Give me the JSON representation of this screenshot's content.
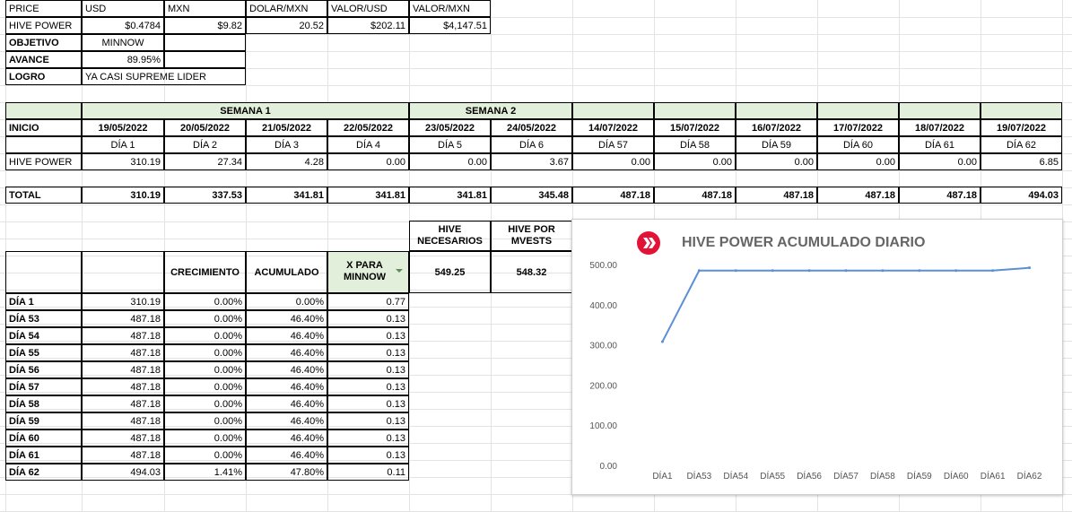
{
  "top": {
    "headers": [
      "PRICE",
      "USD",
      "MXN",
      "DOLAR/MXN",
      "VALOR/USD",
      "VALOR/MXN"
    ],
    "row_label": "HIVE POWER",
    "values": [
      "$0.4784",
      "$9.82",
      "20.52",
      "$202.11",
      "$4,147.51"
    ],
    "objetivo_label": "OBJETIVO",
    "objetivo_value": "MINNOW",
    "avance_label": "AVANCE",
    "avance_value": "89.95%",
    "logro_label": "LOGRO",
    "logro_value": "YA CASI SUPREME LIDER"
  },
  "week_table": {
    "semana1": "SEMANA 1",
    "semana2": "SEMANA 2",
    "inicio_label": "INICIO",
    "dates": [
      "19/05/2022",
      "20/05/2022",
      "21/05/2022",
      "22/05/2022",
      "23/05/2022",
      "24/05/2022",
      "14/07/2022",
      "15/07/2022",
      "16/07/2022",
      "17/07/2022",
      "18/07/2022",
      "19/07/2022"
    ],
    "days": [
      "DÍA 1",
      "DÍA 2",
      "DÍA 3",
      "DÍA 4",
      "DÍA 5",
      "DÍA 6",
      "DÍA 57",
      "DÍA 58",
      "DÍA 59",
      "DÍA 60",
      "DÍA 61",
      "DÍA 62"
    ],
    "hp_label": "HIVE POWER",
    "hp": [
      "310.19",
      "27.34",
      "4.28",
      "0.00",
      "0.00",
      "3.67",
      "0.00",
      "0.00",
      "0.00",
      "0.00",
      "0.00",
      "6.85"
    ],
    "total_label": "TOTAL",
    "total": [
      "310.19",
      "337.53",
      "341.81",
      "341.81",
      "341.81",
      "345.48",
      "487.18",
      "487.18",
      "487.18",
      "487.18",
      "487.18",
      "494.03"
    ]
  },
  "needs": {
    "necesarios_label": "HIVE NECESARIOS",
    "necesarios_value": "549.25",
    "mvests_label": "HIVE POR MVESTS",
    "mvests_value": "548.32"
  },
  "growth_table": {
    "headers": [
      "CRECIMIENTO",
      "ACUMULADO",
      "X PARA MINNOW"
    ],
    "rows": [
      [
        "DÍA 1",
        "310.19",
        "0.00%",
        "0.00%",
        "0.77"
      ],
      [
        "DÍA 53",
        "487.18",
        "0.00%",
        "46.40%",
        "0.13"
      ],
      [
        "DÍA 54",
        "487.18",
        "0.00%",
        "46.40%",
        "0.13"
      ],
      [
        "DÍA 55",
        "487.18",
        "0.00%",
        "46.40%",
        "0.13"
      ],
      [
        "DÍA 56",
        "487.18",
        "0.00%",
        "46.40%",
        "0.13"
      ],
      [
        "DÍA 57",
        "487.18",
        "0.00%",
        "46.40%",
        "0.13"
      ],
      [
        "DÍA 58",
        "487.18",
        "0.00%",
        "46.40%",
        "0.13"
      ],
      [
        "DÍA 59",
        "487.18",
        "0.00%",
        "46.40%",
        "0.13"
      ],
      [
        "DÍA 60",
        "487.18",
        "0.00%",
        "46.40%",
        "0.13"
      ],
      [
        "DÍA 61",
        "487.18",
        "0.00%",
        "46.40%",
        "0.13"
      ],
      [
        "DÍA 62",
        "494.03",
        "1.41%",
        "47.80%",
        "0.11"
      ]
    ]
  },
  "chart_data": {
    "type": "line",
    "title": "HIVE POWER ACUMULADO DIARIO",
    "categories": [
      "DÍA1",
      "DÍA53",
      "DÍA54",
      "DÍA55",
      "DÍA56",
      "DÍA57",
      "DÍA58",
      "DÍA59",
      "DÍA60",
      "DÍA61",
      "DÍA62"
    ],
    "series": [
      {
        "values": [
          310.19,
          487.18,
          487.18,
          487.18,
          487.18,
          487.18,
          487.18,
          487.18,
          487.18,
          487.18,
          494.03
        ]
      }
    ],
    "ylim": [
      0,
      500
    ],
    "yticks": [
      "0.00",
      "100.00",
      "200.00",
      "300.00",
      "400.00",
      "500.00"
    ],
    "line_color": "#5b8fd6",
    "grid": false,
    "legend": "none"
  },
  "colors": {
    "header_green": "#e2efda",
    "hive_red": "#e31337"
  }
}
